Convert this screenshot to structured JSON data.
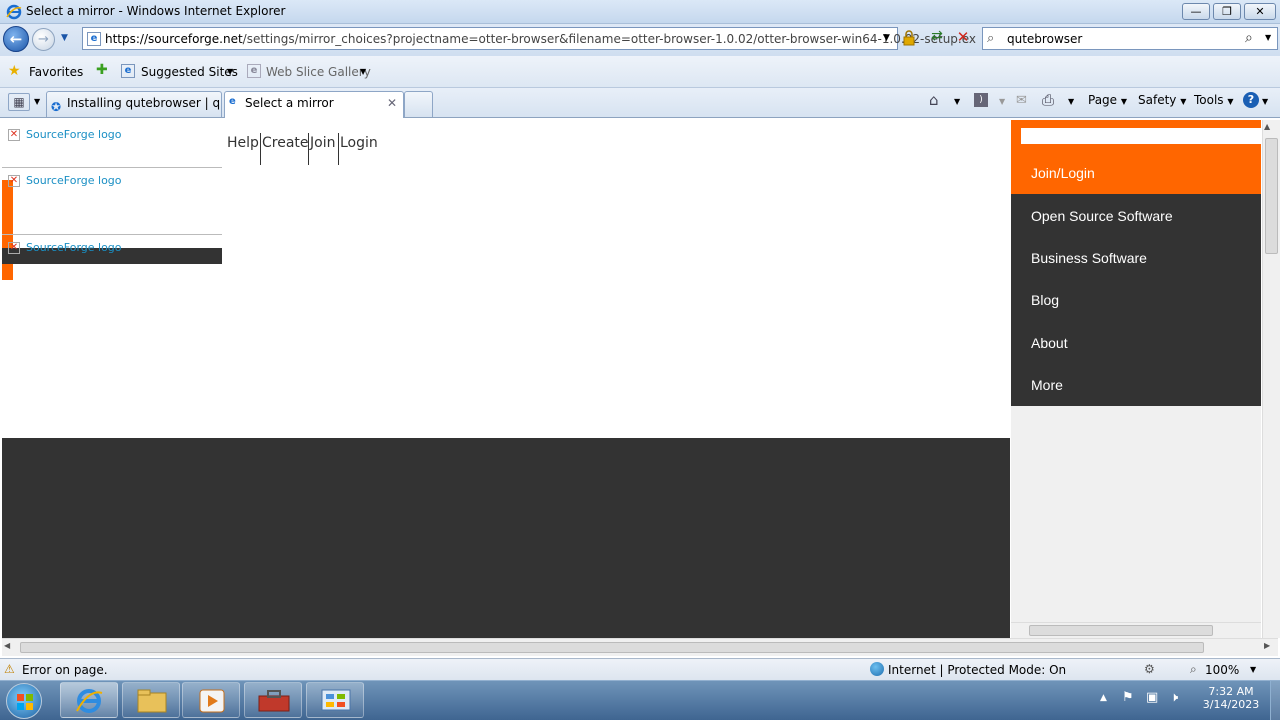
{
  "window": {
    "title": "Select a mirror - Windows Internet Explorer"
  },
  "address": {
    "url_host": "https://sourceforge.net",
    "url_path": "/settings/mirror_choices?projectname=otter-browser&filename=otter-browser-1.0.02/otter-browser-win64-1.0.02-setup.ex"
  },
  "search": {
    "value": "qutebrowser"
  },
  "favorites": {
    "label": "Favorites",
    "suggested": "Suggested Sites",
    "webslice": "Web Slice Gallery"
  },
  "tabs": [
    {
      "label": "Installing qutebrowser | qu..."
    },
    {
      "label": "Select a mirror"
    }
  ],
  "commands": {
    "page": "Page",
    "safety": "Safety",
    "tools": "Tools"
  },
  "page": {
    "logo_alt": "SourceForge logo",
    "topnav": [
      "Help",
      "Create",
      "Join",
      "Login"
    ],
    "menu": [
      "Join/Login",
      "Open Source Software",
      "Business Software",
      "Blog",
      "About",
      "More"
    ],
    "accent": "#ff6600",
    "dark": "#333333"
  },
  "status": {
    "left": "Error on page.",
    "zone": "Internet | Protected Mode: On",
    "zoom": "100%"
  },
  "clock": {
    "time": "7:32 AM",
    "date": "3/14/2023"
  }
}
